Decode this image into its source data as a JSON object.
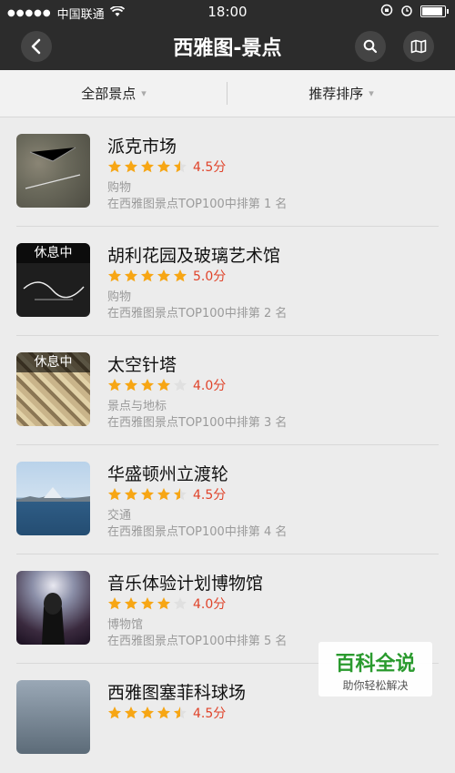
{
  "status_bar": {
    "carrier": "中国联通",
    "time": "18:00"
  },
  "nav": {
    "title": "西雅图-景点"
  },
  "filters": {
    "all_label": "全部景点",
    "sort_label": "推荐排序"
  },
  "items": [
    {
      "name": "派克市场",
      "rating": 4.5,
      "score_text": "4.5分",
      "category": "购物",
      "rank_text": "在西雅图景点TOP100中排第 1 名",
      "badge": ""
    },
    {
      "name": "胡利花园及玻璃艺术馆",
      "rating": 5.0,
      "score_text": "5.0分",
      "category": "购物",
      "rank_text": "在西雅图景点TOP100中排第 2 名",
      "badge": "休息中"
    },
    {
      "name": "太空针塔",
      "rating": 4.0,
      "score_text": "4.0分",
      "category": "景点与地标",
      "rank_text": "在西雅图景点TOP100中排第 3 名",
      "badge": "休息中"
    },
    {
      "name": "华盛顿州立渡轮",
      "rating": 4.5,
      "score_text": "4.5分",
      "category": "交通",
      "rank_text": "在西雅图景点TOP100中排第 4 名",
      "badge": ""
    },
    {
      "name": "音乐体验计划博物馆",
      "rating": 4.0,
      "score_text": "4.0分",
      "category": "博物馆",
      "rank_text": "在西雅图景点TOP100中排第 5 名",
      "badge": ""
    },
    {
      "name": "西雅图塞菲科球场",
      "rating": 4.5,
      "score_text": "4.5分",
      "category": "",
      "rank_text": "",
      "badge": ""
    }
  ],
  "watermark": {
    "logo": "百科全说",
    "tagline": "助你轻松解决"
  },
  "colors": {
    "star": "#f7a614",
    "score": "#e0432a"
  }
}
